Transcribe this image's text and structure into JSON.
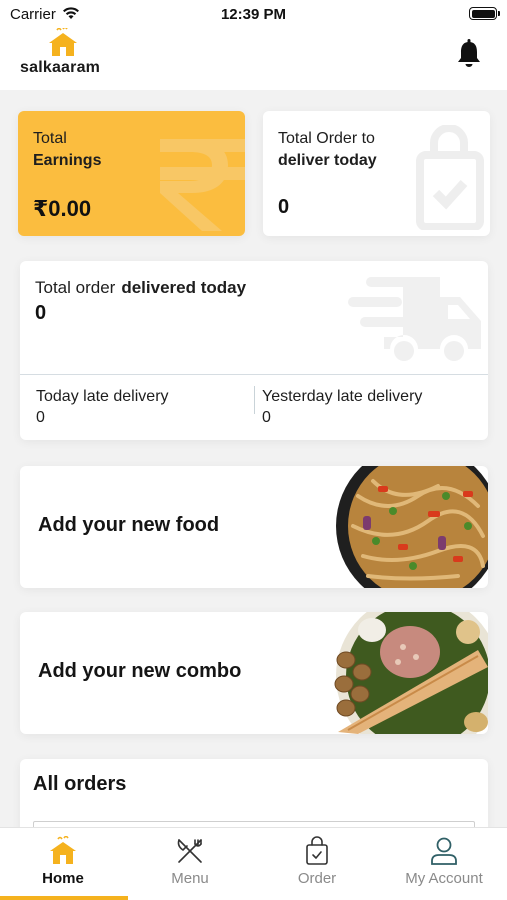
{
  "status_bar": {
    "carrier": "Carrier",
    "time": "12:39 PM"
  },
  "header": {
    "logo_text": "salkaaram",
    "icons": [
      "house-logo-icon",
      "bell-icon"
    ]
  },
  "stats": {
    "earnings": {
      "label_line1": "Total",
      "label_line2": "Earnings",
      "value": "₹0.00"
    },
    "to_deliver": {
      "label_line1": "Total Order to",
      "label_line2": "deliver today",
      "value": "0"
    },
    "delivered": {
      "label_regular": "Total order",
      "label_bold": "delivered today",
      "value": "0",
      "today_late_label": "Today late delivery",
      "today_late_value": "0",
      "yesterday_late_label": "Yesterday late delivery",
      "yesterday_late_value": "0"
    }
  },
  "actions": {
    "add_food": "Add your new food",
    "add_combo": "Add your new combo"
  },
  "orders": {
    "title": "All orders"
  },
  "bottom_nav": {
    "items": [
      {
        "label": "Home",
        "icon": "home-icon",
        "active": true
      },
      {
        "label": "Menu",
        "icon": "fork-knife-icon",
        "active": false
      },
      {
        "label": "Order",
        "icon": "shopping-bag-icon",
        "active": false
      },
      {
        "label": "My Account",
        "icon": "user-icon",
        "active": false
      }
    ]
  },
  "colors": {
    "accent": "#fbbd3f",
    "indicator": "#f5b21e",
    "background": "#f2f2f2"
  }
}
